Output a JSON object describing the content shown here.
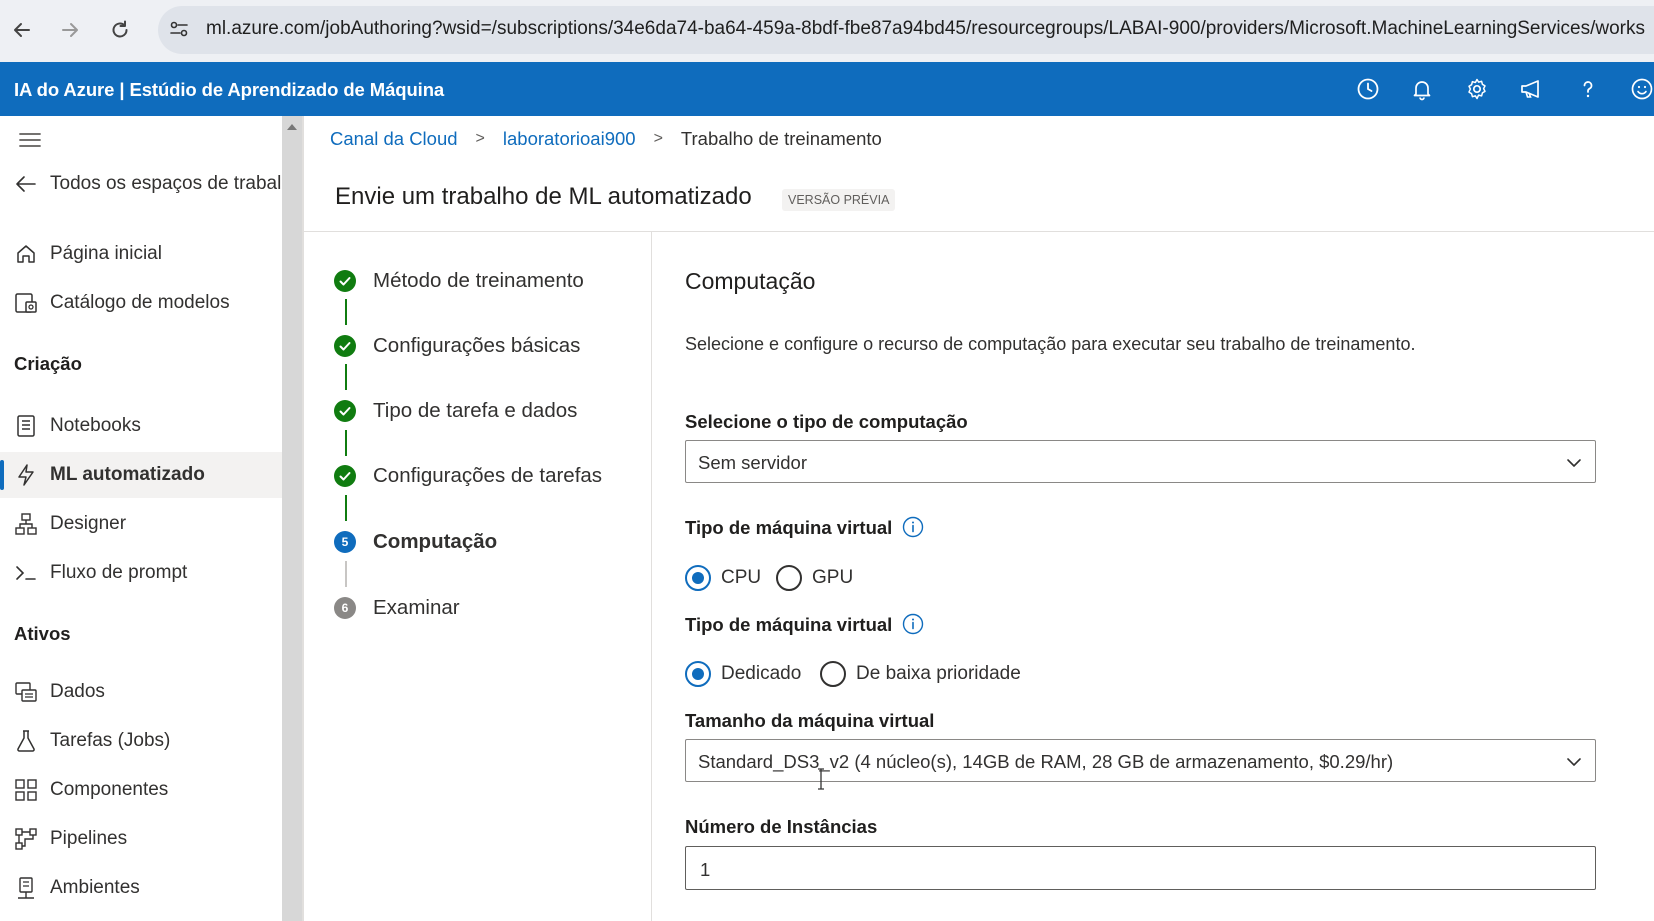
{
  "browser": {
    "url": "ml.azure.com/jobAuthoring?wsid=/subscriptions/34e6da74-ba64-459a-8bdf-fbe87a94bd45/resourcegroups/LABAI-900/providers/Microsoft.MachineLearningServices/works"
  },
  "header": {
    "title": "IA do Azure | Estúdio de Aprendizado de Máquina",
    "icons": [
      "history-icon",
      "bell-icon",
      "gear-icon",
      "megaphone-icon",
      "help-icon",
      "smiley-icon"
    ]
  },
  "sidebar": {
    "back_label": "Todos os espaços de trabal",
    "home": "Página inicial",
    "catalog": "Catálogo de modelos",
    "section_creation": "Criação",
    "notebooks": "Notebooks",
    "automl": "ML automatizado",
    "designer": "Designer",
    "prompt_flow": "Fluxo de prompt",
    "section_assets": "Ativos",
    "data": "Dados",
    "jobs": "Tarefas (Jobs)",
    "components": "Componentes",
    "pipelines": "Pipelines",
    "environments": "Ambientes"
  },
  "breadcrumb": {
    "item1": "Canal da Cloud",
    "item2": "laboratorioai900",
    "current": "Trabalho de treinamento"
  },
  "page": {
    "title": "Envie um trabalho de ML automatizado",
    "badge": "VERSÃO PRÉVIA"
  },
  "steps": [
    {
      "label": "Método de treinamento",
      "status": "done"
    },
    {
      "label": "Configurações básicas",
      "status": "done"
    },
    {
      "label": "Tipo de tarefa e dados",
      "status": "done"
    },
    {
      "label": "Configurações de tarefas",
      "status": "done"
    },
    {
      "label": "Computação",
      "status": "current",
      "number": "5"
    },
    {
      "label": "Examinar",
      "status": "pending",
      "number": "6"
    }
  ],
  "form": {
    "title": "Computação",
    "description": "Selecione e configure o recurso de computação para executar seu trabalho de treinamento.",
    "compute_type_label": "Selecione o tipo de computação",
    "compute_type_value": "Sem servidor",
    "vm_type_label": "Tipo de máquina virtual",
    "vm_type_options": [
      "CPU",
      "GPU"
    ],
    "vm_type_selected": "CPU",
    "vm_priority_label": "Tipo de máquina virtual",
    "vm_priority_options": [
      "Dedicado",
      "De baixa prioridade"
    ],
    "vm_priority_selected": "Dedicado",
    "vm_size_label": "Tamanho da máquina virtual",
    "vm_size_value": "Standard_DS3_v2 (4 núcleo(s), 14GB de RAM, 28 GB de armazenamento, $0.29/hr)",
    "instances_label": "Número de Instâncias",
    "instances_value": "1"
  },
  "colors": {
    "accent": "#0f6cbd",
    "success": "#107c10",
    "pending": "#8a8886"
  }
}
